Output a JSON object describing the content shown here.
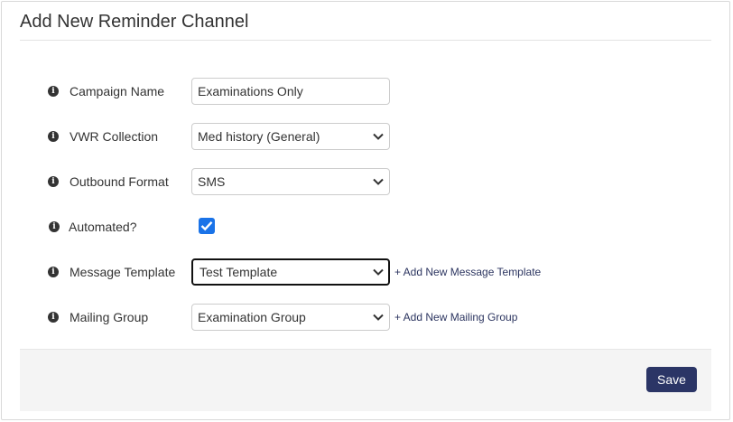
{
  "form": {
    "title": "Add New Reminder Channel",
    "fields": {
      "campaign_name": {
        "label": "Campaign Name",
        "value": "Examinations Only"
      },
      "vwr_collection": {
        "label": "VWR Collection",
        "value": "Med history (General)"
      },
      "outbound_format": {
        "label": "Outbound Format",
        "value": "SMS"
      },
      "automated": {
        "label": "Automated?",
        "checked": true
      },
      "message_template": {
        "label": "Message Template",
        "value": "Test Template",
        "add_link": "+ Add New Message Template"
      },
      "mailing_group": {
        "label": "Mailing Group",
        "value": "Examination Group",
        "add_link": "+ Add New Mailing Group"
      }
    },
    "info_icon_glyph": "i",
    "save_label": "Save"
  },
  "icons": {
    "info": "info-circle-icon",
    "dropdown": "chevron-down-icon",
    "check": "checkmark-icon"
  },
  "colors": {
    "accent": "#2b3566",
    "checkbox": "#1a73e8",
    "link": "#2c3560",
    "footer_bg": "#f4f4f4"
  }
}
